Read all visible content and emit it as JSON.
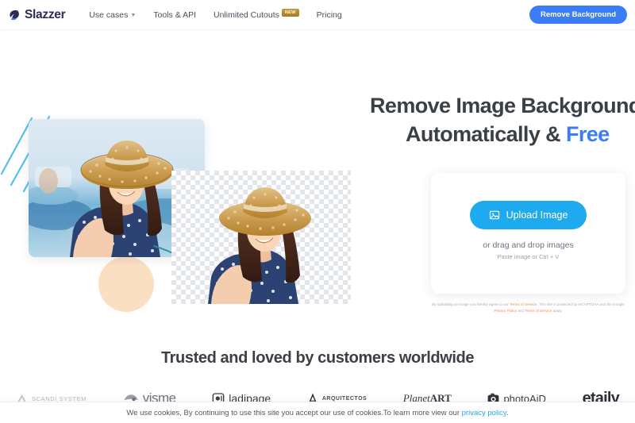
{
  "navbar": {
    "brand": "Slazzer",
    "brand_icon": "slazzer-logo-icon",
    "links": [
      {
        "label": "Use cases",
        "has_caret": true,
        "badge": null
      },
      {
        "label": "Tools & API",
        "has_caret": false,
        "badge": null
      },
      {
        "label": "Unlimited Cutouts",
        "has_caret": false,
        "badge": "New"
      },
      {
        "label": "Pricing",
        "has_caret": false,
        "badge": null
      }
    ],
    "cta": "Remove Background"
  },
  "hero": {
    "heading_line1": "Remove Image Backgrounds",
    "heading_line2_plain": "Automatically & ",
    "heading_line2_accent": "Free",
    "upload": {
      "button_label": "Upload Image",
      "button_icon": "image-icon",
      "drag_text": "or drag and drop images",
      "paste_text": "Paste image or Ctrl + V"
    },
    "legal": {
      "part1": "By uploading an image you hereby agree to our ",
      "link1": "Terms of Service",
      "part2": ". This site is protected by reCAPTCHA and the Google ",
      "link2": "Privacy Policy",
      "part3": " and ",
      "link3": "Terms of Service",
      "part4": " apply."
    },
    "illustration": {
      "before_alt": "woman-in-straw-hat-original-photo",
      "after_alt": "woman-in-straw-hat-background-removed",
      "arrow_alt": "curved-arrow-icon"
    }
  },
  "trusted": {
    "title": "Trusted and loved by customers worldwide",
    "logos": [
      {
        "name": "SCANDI SYSTEM",
        "key": "scandi"
      },
      {
        "name": "visme",
        "key": "visme"
      },
      {
        "name": "ladipage",
        "key": "ladipage"
      },
      {
        "name": "ARQUITECTOS",
        "key": "arquitectos"
      },
      {
        "name": "PlanetART",
        "key": "planetart"
      },
      {
        "name": "photoAiD",
        "key": "photoaid"
      },
      {
        "name": "etaily",
        "key": "etaily"
      }
    ]
  },
  "cookie_bar": {
    "text": "We use cookies, By continuing to use this site you accept our use of cookies.To learn more view our ",
    "link": "privacy policy",
    "suffix": "."
  },
  "colors": {
    "brand_navy": "#2b2d57",
    "cta_blue": "#3b7df6",
    "upload_blue": "#1eaaee",
    "accent_free": "#3b7df6",
    "cookie_link": "#21aee0",
    "peach": "#fbdfc2",
    "deco_line": "#35b6e8",
    "badge_gold": "#c79a3a"
  }
}
